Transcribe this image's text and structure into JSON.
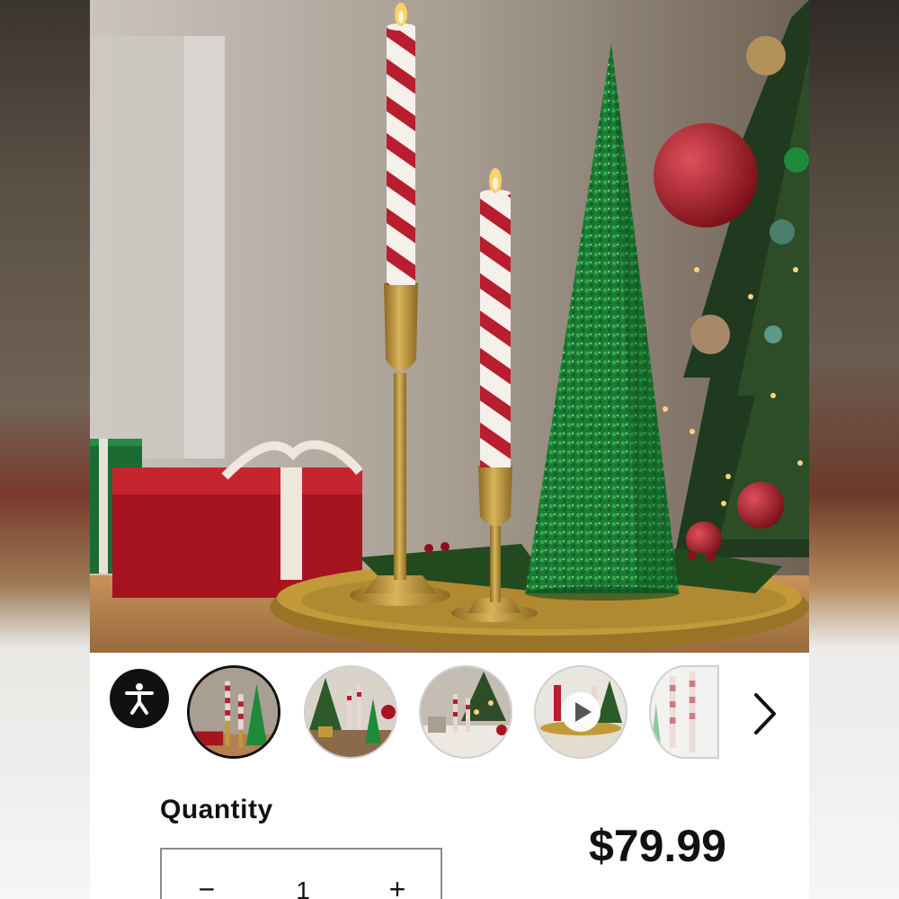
{
  "product": {
    "quantity_label": "Quantity",
    "quantity_value": "1",
    "decrement_symbol": "−",
    "increment_symbol": "+",
    "price": "$79.99"
  },
  "carousel": {
    "accessibility_icon": "accessibility-icon",
    "next_icon": "chevron-right-icon",
    "play_icon": "play-icon",
    "thumbnails": [
      {
        "label": "candles-and-tree-cone",
        "selected": true
      },
      {
        "label": "lifestyle-scene-with-tree",
        "selected": false
      },
      {
        "label": "table-scene",
        "selected": false
      },
      {
        "label": "video",
        "selected": false,
        "is_video": true
      },
      {
        "label": "candle-close-up",
        "selected": false
      }
    ]
  },
  "colors": {
    "text": "#111111",
    "accent_red": "#b3142a",
    "glitter_green": "#1f8a3a",
    "gold": "#c39a3a"
  }
}
